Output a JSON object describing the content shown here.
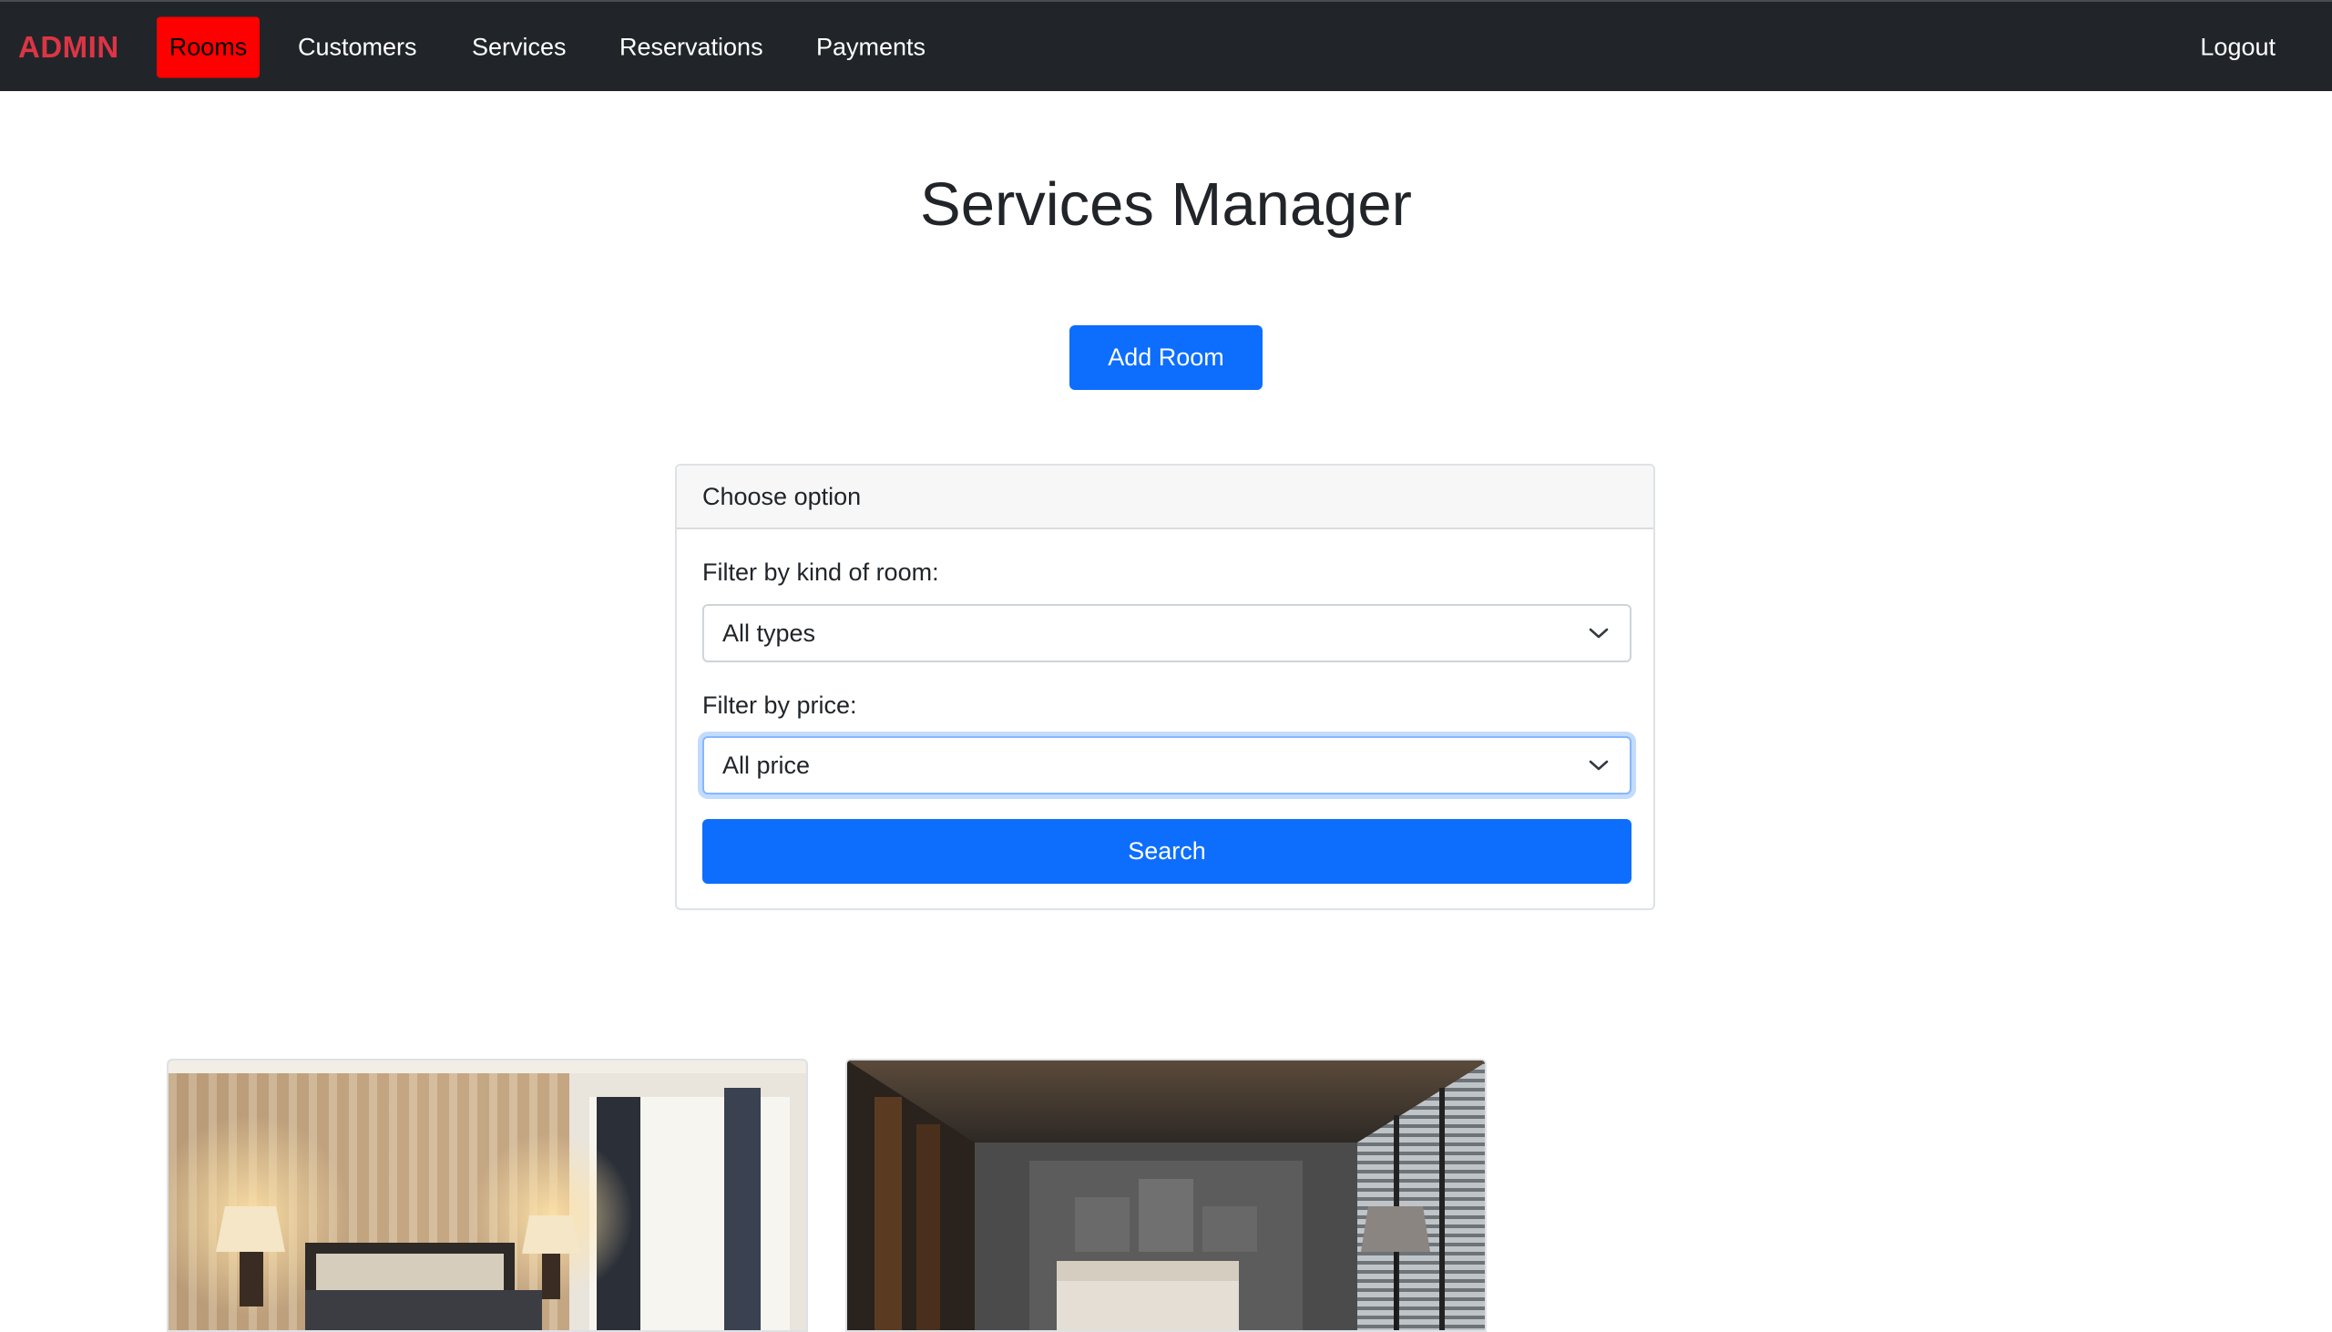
{
  "navbar": {
    "brand": "ADMIN",
    "items": [
      {
        "label": "Rooms",
        "active": true
      },
      {
        "label": "Customers",
        "active": false
      },
      {
        "label": "Services",
        "active": false
      },
      {
        "label": "Reservations",
        "active": false
      },
      {
        "label": "Payments",
        "active": false
      }
    ],
    "logout": "Logout"
  },
  "main": {
    "title": "Services Manager",
    "add_button": "Add Room"
  },
  "filter": {
    "header": "Choose option",
    "kind_label": "Filter by kind of room:",
    "kind_value": "All types",
    "price_label": "Filter by price:",
    "price_value": "All price",
    "search_button": "Search"
  },
  "colors": {
    "navbar_bg": "#212529",
    "brand": "#dc3545",
    "active_tab": "#ff0000",
    "primary": "#0d6efd"
  },
  "icons": {
    "select_chevron": "chevron-down-icon"
  }
}
